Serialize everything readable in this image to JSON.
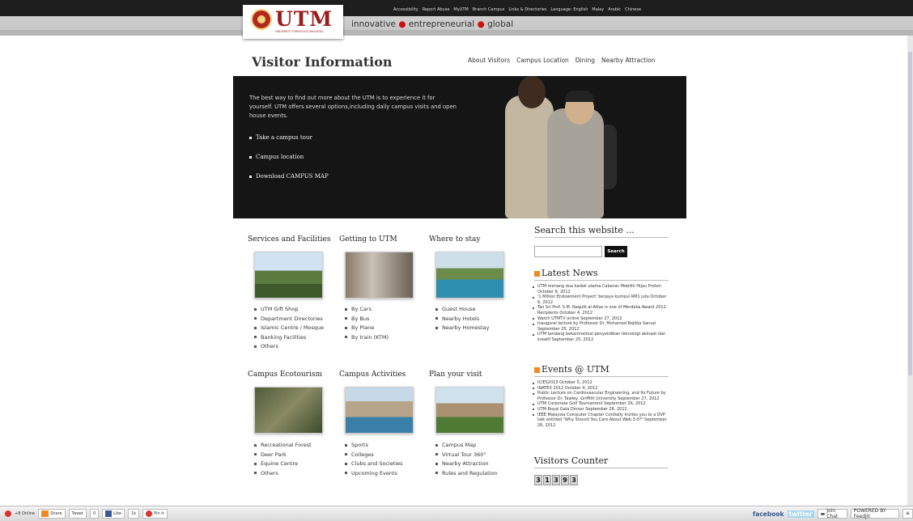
{
  "header": {
    "logo_text": "UTM",
    "logo_subtext": "UNIVERSITI TEKNOLOGI MALAYSIA",
    "tagline": [
      "innovative",
      "entrepreneurial",
      "global"
    ],
    "utility_links": [
      "Accessibility",
      "Report Abuse",
      "MyUTM",
      "Branch Campus",
      "Links & Directories",
      "Language: English",
      "Malay",
      "Arabic",
      "Chinese"
    ]
  },
  "page": {
    "title": "Visitor Information",
    "subnav": [
      "About Visitors",
      "Campus Location",
      "Dining",
      "Nearby Attraction"
    ]
  },
  "hero": {
    "intro": "The best way to find out more about the UTM is to experience it for yourself. UTM offers several options,including daily campus visits and open house events.",
    "links": [
      "Take a campus tour",
      "Campus location",
      "Download CAMPUS MAP"
    ]
  },
  "sections": [
    {
      "title": "Services and Facilities",
      "items": [
        "UTM Gift Shop",
        "Department Directories",
        "Islamic Centre / Mosque",
        "Banking Facilities",
        "Others"
      ]
    },
    {
      "title": "Getting to UTM",
      "items": [
        "By Cars",
        "By Bus",
        "By Plane",
        "By train (KTM)"
      ]
    },
    {
      "title": "Where to stay",
      "items": [
        "Guest House",
        "Nearby Hotels",
        "Nearby Homestay"
      ]
    },
    {
      "title": "Campus Ecotourism",
      "items": [
        "Recreational Forest",
        "Deer Park",
        "Equine Centre",
        "Others"
      ]
    },
    {
      "title": "Campus Activities",
      "items": [
        "Sports",
        "Colleges",
        "Clubs and Societies",
        "Upcoming Events"
      ]
    },
    {
      "title": "Plan your visit",
      "items": [
        "Campus Map",
        "Virtual Tour 360°",
        "Nearby Attraction",
        "Rules and Regulation"
      ]
    }
  ],
  "sidebar": {
    "search_title": "Search this website ...",
    "search_placeholder": "",
    "search_button": "Search",
    "latest_news_title": "Latest News",
    "latest_news": [
      "UTM menang dua kadak utama Cabaran Mobiliti Hijau Proton October 8, 2012",
      "'1 Million Endowment Project' berjaya kumpul RM1 juta October 6, 2012",
      "Tan Sri Prof. S.M. Naquib al-Attas is one of Merdeka Award 2012 Recipients October 4, 2012",
      "Watch UTMTV online September 27, 2012",
      "Inaugural lecture by Professor Dr. Mohamad Rojibia Sanusi September 25, 2012",
      "UTM tandang bekanmalmal penyelidikan teknologi akinaat dan kreatif September 25, 2012"
    ],
    "events_title": "Events @ UTM",
    "events": [
      "ICIES2013 October 5, 2012",
      "INATEX 2012 October 4, 2012",
      "Public Lecture on Cardiovascular Engineering, and Its Future by Professor Dr. Tawley, Griffith University September 27, 2012",
      "UTM Corporate Golf Tournament September 26, 2012",
      "UTM Royal Gala Dinner September 26, 2012",
      "IEEE Malaysia Computer Chapter Cordially Invites you to a DVP talk entitled \"Why Should You Care About Web 3.0?\" September 26, 2012"
    ],
    "counter_title": "Visitors Counter",
    "counter_digits": [
      "3",
      "1",
      "3",
      "9",
      "3"
    ]
  },
  "bottombar": {
    "online": "+8 Online",
    "share": "Share",
    "tweet": "Tweet",
    "tweet_count": "0",
    "like": "Like",
    "like_count": "1k",
    "pinit": "Pin it",
    "facebook": "facebook",
    "twitter": "twitter",
    "join_chat": "Join Chat",
    "powered": "POWERED BY Feedjit"
  }
}
